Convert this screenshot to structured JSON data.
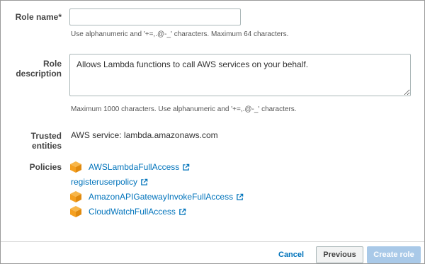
{
  "role_name": {
    "label": "Role name*",
    "value": "",
    "hint": "Use alphanumeric and '+=,.@-_' characters. Maximum 64 characters."
  },
  "role_description": {
    "label": "Role description",
    "value": "Allows Lambda functions to call AWS services on your behalf.",
    "hint": "Maximum 1000 characters. Use alphanumeric and '+=,.@-_' characters."
  },
  "trusted_entities": {
    "label": "Trusted entities",
    "value": "AWS service: lambda.amazonaws.com"
  },
  "policies": {
    "label": "Policies",
    "items": [
      {
        "name": "AWSLambdaFullAccess",
        "icon": "aws-managed-policy-icon"
      },
      {
        "name": "registeruserpolicy",
        "icon": ""
      },
      {
        "name": "AmazonAPIGatewayInvokeFullAccess",
        "icon": "aws-managed-policy-icon"
      },
      {
        "name": "CloudWatchFullAccess",
        "icon": "aws-managed-policy-icon"
      }
    ]
  },
  "footer": {
    "cancel_label": "Cancel",
    "previous_label": "Previous",
    "create_label": "Create role"
  },
  "colors": {
    "link": "#0073bb",
    "policy_icon": "#f5a020",
    "create_button_disabled": "#a9c9e8"
  }
}
